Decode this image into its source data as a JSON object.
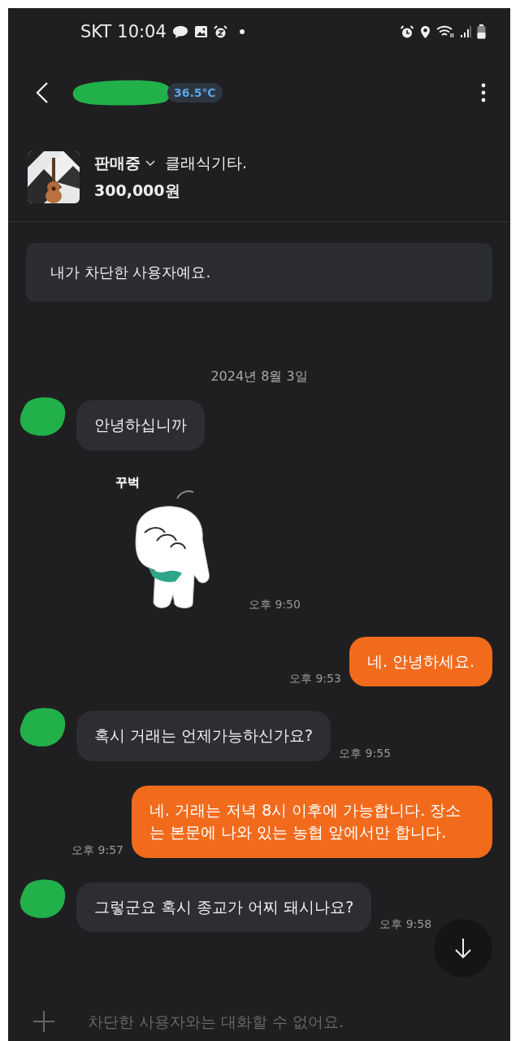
{
  "status_bar": {
    "carrier": "SKT",
    "time": "10:04"
  },
  "header": {
    "temperature": "36.5℃"
  },
  "product": {
    "status": "판매중",
    "title": "클래식기타.",
    "price": "300,000원"
  },
  "notice": "내가 차단한 사용자예요.",
  "date": "2024년 8월 3일",
  "messages": [
    {
      "kind": "incoming",
      "text": "안녕하십니까"
    },
    {
      "kind": "sticker",
      "caption": "꾸벅",
      "time": "오후 9:50"
    },
    {
      "kind": "outgoing",
      "text": "네. 안녕하세요.",
      "time": "오후 9:53"
    },
    {
      "kind": "incoming",
      "text": "혹시 거래는 언제가능하신가요?",
      "time": "오후 9:55"
    },
    {
      "kind": "outgoing",
      "text": "네. 거래는 저녁 8시 이후에 가능합니다. 장소는 본문에 나와 있는 농협 앞에서만 합니다.",
      "time": "오후 9:57"
    },
    {
      "kind": "incoming",
      "text": "그렇군요 혹시 종교가 어찌 돼시나요?",
      "time": "오후 9:58"
    }
  ],
  "input": {
    "placeholder": "차단한 사용자와는 대화할 수 없어요."
  }
}
